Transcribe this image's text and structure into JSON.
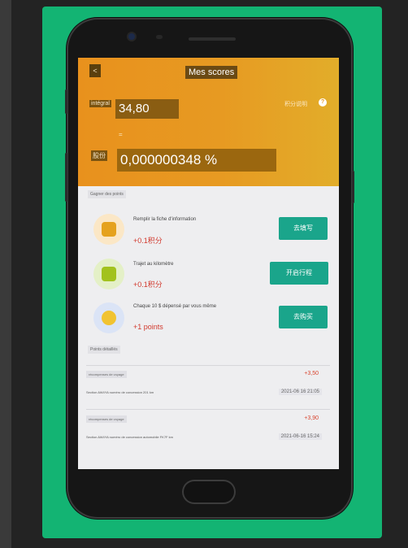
{
  "app": {
    "title": "Mes scores",
    "back_label": "<"
  },
  "summary": {
    "points_label": "intégral",
    "points_value": "34,80",
    "equals_sign": "=",
    "share_label": "股份",
    "share_value": "0,000000348 %",
    "help_text": "积分说明",
    "help_icon_char": "?"
  },
  "tasks_section_label": "Gagner des points",
  "tasks": [
    {
      "description": "Remplir la fiche d'information",
      "reward": "+0.1积分",
      "button": "去填写",
      "icon": "fuel-icon",
      "icon_bg": "#fbe7c6",
      "icon_color": "#e5a21e"
    },
    {
      "description": "Trajet au kilomètre",
      "reward": "+0.1积分",
      "button": "开启行程",
      "icon": "car-icon",
      "icon_bg": "#e4f0c7",
      "icon_color": "#a2c21e"
    },
    {
      "description": "Chaque 10 $ dépensé par vous même",
      "reward": "+1 points",
      "button": "去购买",
      "icon": "coin-icon",
      "icon_bg": "#dbe4f6",
      "icon_color": "#f1c331"
    }
  ],
  "records_section_label": "Points détaillés",
  "records": [
    {
      "label": "récompenses de voyage",
      "amount": "+3,50",
      "description": "Section AW4YA numéro de concession 201 km",
      "date": "2021-06 16 21:05"
    },
    {
      "label": "récompenses de voyage",
      "amount": "+3,90",
      "description": "Section AW4YA numéro de concession automobile FK7F km",
      "date": "2021-06-16 15:24"
    }
  ],
  "colors": {
    "accent": "#1aa58b",
    "header_start": "#e8911d",
    "header_end": "#e2ad2a",
    "reward_red": "#d23a2e",
    "background_green": "#13b473"
  }
}
